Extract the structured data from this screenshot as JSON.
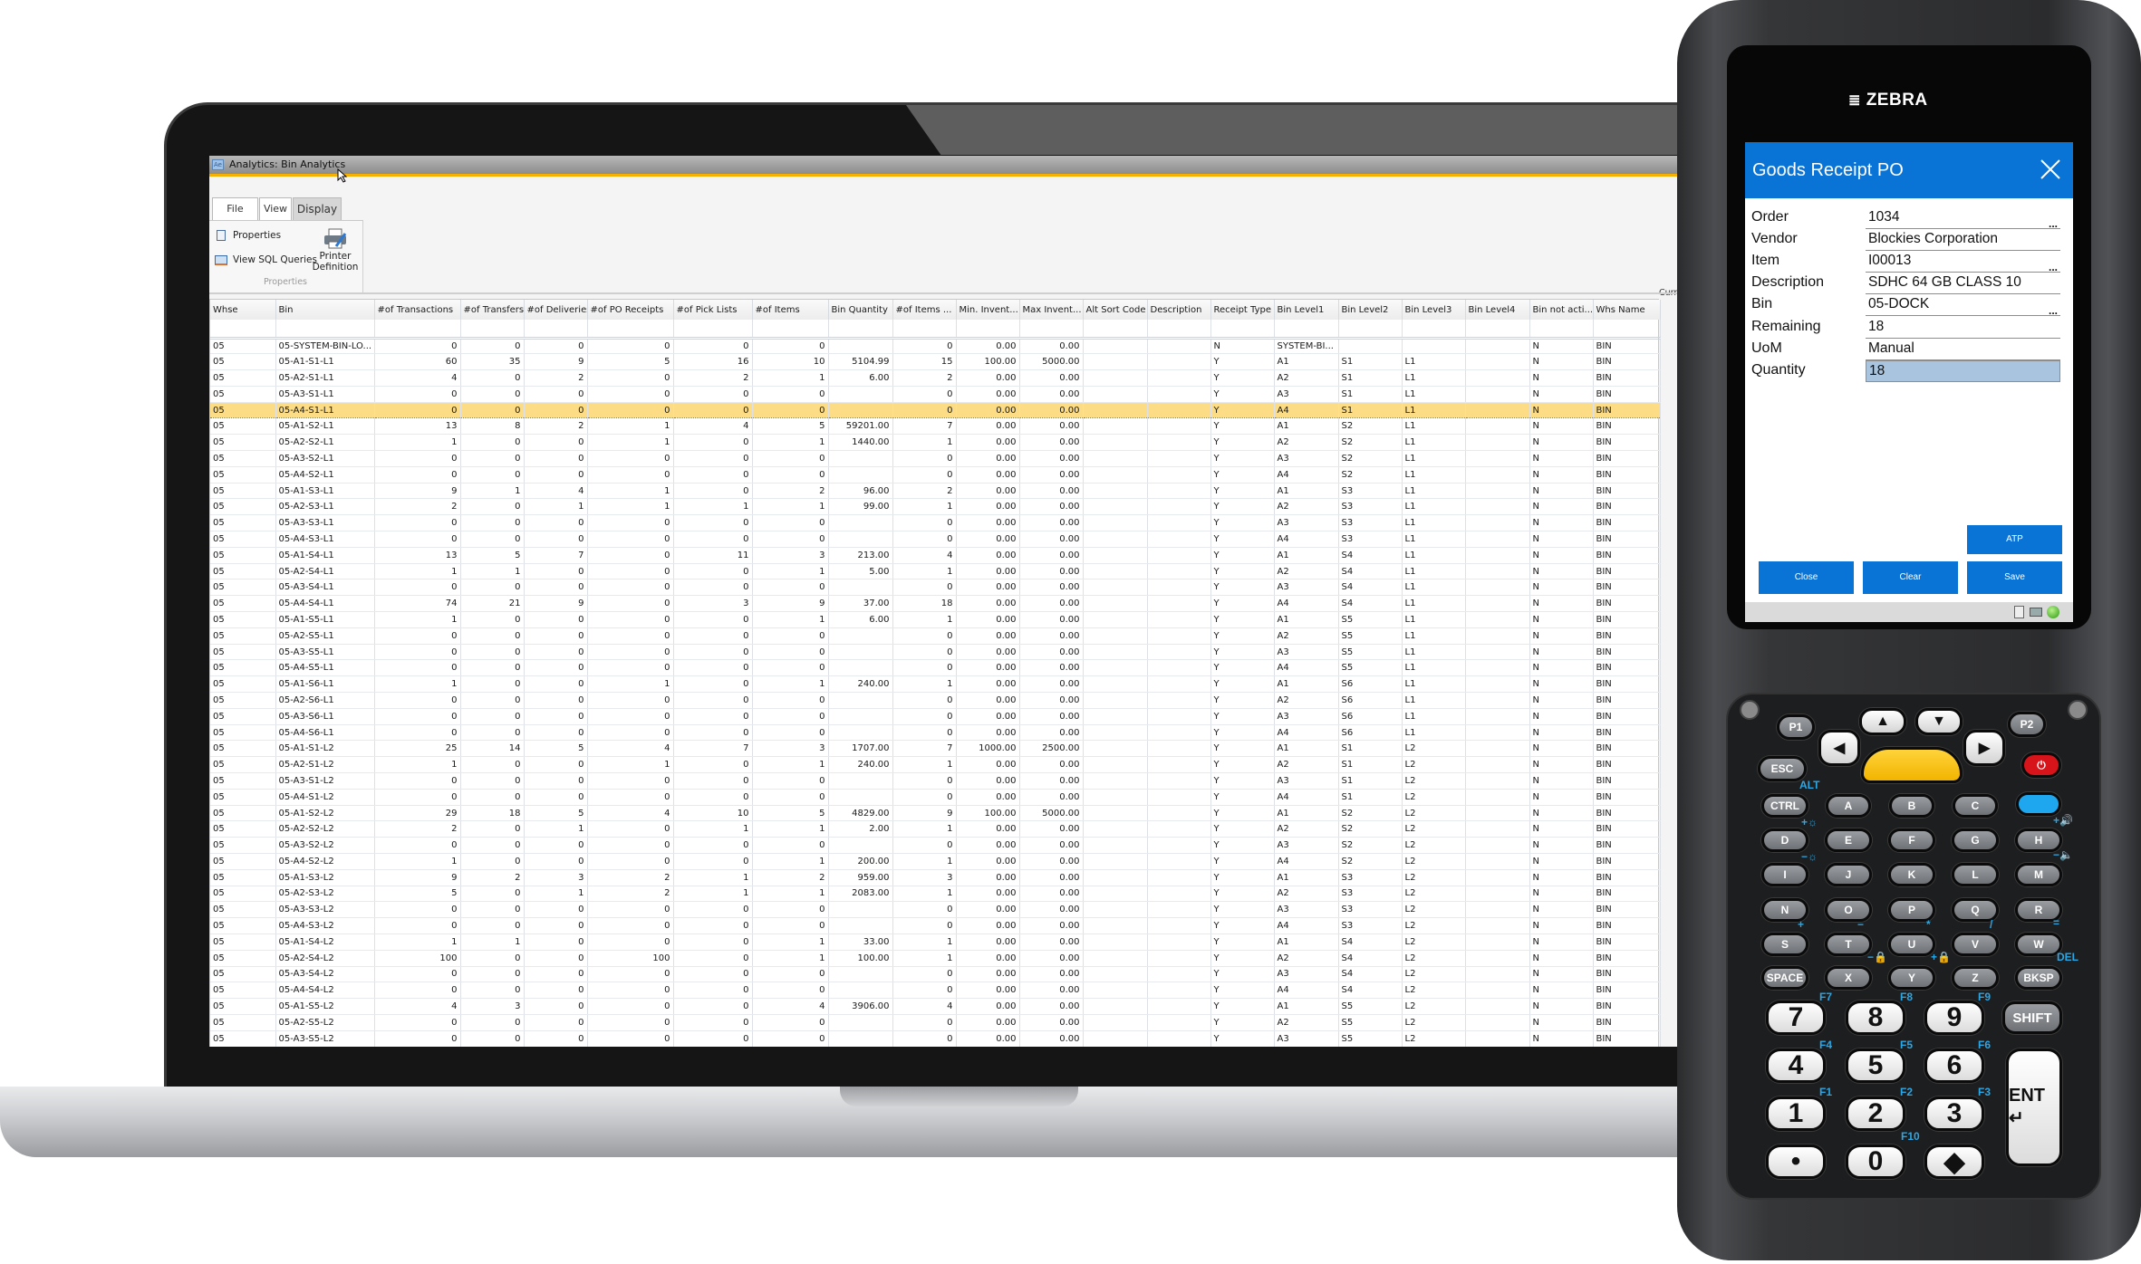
{
  "laptop": {
    "window_title": "Analytics: Bin Analytics",
    "app_icon_label": "Ae",
    "tabs": [
      "File",
      "View",
      "Display"
    ],
    "current_layout_label": "Current Layo",
    "ribbon": {
      "properties_label": "Properties",
      "view_sql_label": "View SQL Queries",
      "printer_line1": "Printer",
      "printer_line2": "Definition",
      "group_label": "Properties"
    },
    "grid": {
      "columns": [
        "Whse",
        "Bin",
        "#of Transactions",
        "#of Transfers",
        "#of Deliveries",
        "#of PO Receipts",
        "#of Pick Lists",
        "#of Items",
        "Bin Quantity",
        "#of Items ...",
        "Min. Invent...",
        "Max Invent...",
        "Alt Sort Code",
        "Description",
        "Receipt Type",
        "Bin Level1",
        "Bin Level2",
        "Bin Level3",
        "Bin Level4",
        "Bin not acti...",
        "Whs Name"
      ],
      "selected_row": 4,
      "selected_color": "#fcdc84",
      "rows": [
        [
          "05",
          "05-SYSTEM-BIN-LO...",
          "0",
          "0",
          "0",
          "0",
          "0",
          "0",
          "",
          "0",
          "0.00",
          "0.00",
          "",
          "",
          "N",
          "SYSTEM-BI...",
          "",
          "",
          "",
          "N",
          "BIN"
        ],
        [
          "05",
          "05-A1-S1-L1",
          "60",
          "35",
          "9",
          "5",
          "16",
          "10",
          "5104.99",
          "15",
          "100.00",
          "5000.00",
          "",
          "",
          "Y",
          "A1",
          "S1",
          "L1",
          "",
          "N",
          "BIN"
        ],
        [
          "05",
          "05-A2-S1-L1",
          "4",
          "0",
          "2",
          "0",
          "2",
          "1",
          "6.00",
          "2",
          "0.00",
          "0.00",
          "",
          "",
          "Y",
          "A2",
          "S1",
          "L1",
          "",
          "N",
          "BIN"
        ],
        [
          "05",
          "05-A3-S1-L1",
          "0",
          "0",
          "0",
          "0",
          "0",
          "0",
          "",
          "0",
          "0.00",
          "0.00",
          "",
          "",
          "Y",
          "A3",
          "S1",
          "L1",
          "",
          "N",
          "BIN"
        ],
        [
          "05",
          "05-A4-S1-L1",
          "0",
          "0",
          "0",
          "0",
          "0",
          "0",
          "",
          "0",
          "0.00",
          "0.00",
          "",
          "",
          "Y",
          "A4",
          "S1",
          "L1",
          "",
          "N",
          "BIN"
        ],
        [
          "05",
          "05-A1-S2-L1",
          "13",
          "8",
          "2",
          "1",
          "4",
          "5",
          "59201.00",
          "7",
          "0.00",
          "0.00",
          "",
          "",
          "Y",
          "A1",
          "S2",
          "L1",
          "",
          "N",
          "BIN"
        ],
        [
          "05",
          "05-A2-S2-L1",
          "1",
          "0",
          "0",
          "1",
          "0",
          "1",
          "1440.00",
          "1",
          "0.00",
          "0.00",
          "",
          "",
          "Y",
          "A2",
          "S2",
          "L1",
          "",
          "N",
          "BIN"
        ],
        [
          "05",
          "05-A3-S2-L1",
          "0",
          "0",
          "0",
          "0",
          "0",
          "0",
          "",
          "0",
          "0.00",
          "0.00",
          "",
          "",
          "Y",
          "A3",
          "S2",
          "L1",
          "",
          "N",
          "BIN"
        ],
        [
          "05",
          "05-A4-S2-L1",
          "0",
          "0",
          "0",
          "0",
          "0",
          "0",
          "",
          "0",
          "0.00",
          "0.00",
          "",
          "",
          "Y",
          "A4",
          "S2",
          "L1",
          "",
          "N",
          "BIN"
        ],
        [
          "05",
          "05-A1-S3-L1",
          "9",
          "1",
          "4",
          "1",
          "0",
          "2",
          "96.00",
          "2",
          "0.00",
          "0.00",
          "",
          "",
          "Y",
          "A1",
          "S3",
          "L1",
          "",
          "N",
          "BIN"
        ],
        [
          "05",
          "05-A2-S3-L1",
          "2",
          "0",
          "1",
          "1",
          "1",
          "1",
          "99.00",
          "1",
          "0.00",
          "0.00",
          "",
          "",
          "Y",
          "A2",
          "S3",
          "L1",
          "",
          "N",
          "BIN"
        ],
        [
          "05",
          "05-A3-S3-L1",
          "0",
          "0",
          "0",
          "0",
          "0",
          "0",
          "",
          "0",
          "0.00",
          "0.00",
          "",
          "",
          "Y",
          "A3",
          "S3",
          "L1",
          "",
          "N",
          "BIN"
        ],
        [
          "05",
          "05-A4-S3-L1",
          "0",
          "0",
          "0",
          "0",
          "0",
          "0",
          "",
          "0",
          "0.00",
          "0.00",
          "",
          "",
          "Y",
          "A4",
          "S3",
          "L1",
          "",
          "N",
          "BIN"
        ],
        [
          "05",
          "05-A1-S4-L1",
          "13",
          "5",
          "7",
          "0",
          "11",
          "3",
          "213.00",
          "4",
          "0.00",
          "0.00",
          "",
          "",
          "Y",
          "A1",
          "S4",
          "L1",
          "",
          "N",
          "BIN"
        ],
        [
          "05",
          "05-A2-S4-L1",
          "1",
          "1",
          "0",
          "0",
          "0",
          "1",
          "5.00",
          "1",
          "0.00",
          "0.00",
          "",
          "",
          "Y",
          "A2",
          "S4",
          "L1",
          "",
          "N",
          "BIN"
        ],
        [
          "05",
          "05-A3-S4-L1",
          "0",
          "0",
          "0",
          "0",
          "0",
          "0",
          "",
          "0",
          "0.00",
          "0.00",
          "",
          "",
          "Y",
          "A3",
          "S4",
          "L1",
          "",
          "N",
          "BIN"
        ],
        [
          "05",
          "05-A4-S4-L1",
          "74",
          "21",
          "9",
          "0",
          "3",
          "9",
          "37.00",
          "18",
          "0.00",
          "0.00",
          "",
          "",
          "Y",
          "A4",
          "S4",
          "L1",
          "",
          "N",
          "BIN"
        ],
        [
          "05",
          "05-A1-S5-L1",
          "1",
          "0",
          "0",
          "0",
          "0",
          "1",
          "6.00",
          "1",
          "0.00",
          "0.00",
          "",
          "",
          "Y",
          "A1",
          "S5",
          "L1",
          "",
          "N",
          "BIN"
        ],
        [
          "05",
          "05-A2-S5-L1",
          "0",
          "0",
          "0",
          "0",
          "0",
          "0",
          "",
          "0",
          "0.00",
          "0.00",
          "",
          "",
          "Y",
          "A2",
          "S5",
          "L1",
          "",
          "N",
          "BIN"
        ],
        [
          "05",
          "05-A3-S5-L1",
          "0",
          "0",
          "0",
          "0",
          "0",
          "0",
          "",
          "0",
          "0.00",
          "0.00",
          "",
          "",
          "Y",
          "A3",
          "S5",
          "L1",
          "",
          "N",
          "BIN"
        ],
        [
          "05",
          "05-A4-S5-L1",
          "0",
          "0",
          "0",
          "0",
          "0",
          "0",
          "",
          "0",
          "0.00",
          "0.00",
          "",
          "",
          "Y",
          "A4",
          "S5",
          "L1",
          "",
          "N",
          "BIN"
        ],
        [
          "05",
          "05-A1-S6-L1",
          "1",
          "0",
          "0",
          "1",
          "0",
          "1",
          "240.00",
          "1",
          "0.00",
          "0.00",
          "",
          "",
          "Y",
          "A1",
          "S6",
          "L1",
          "",
          "N",
          "BIN"
        ],
        [
          "05",
          "05-A2-S6-L1",
          "0",
          "0",
          "0",
          "0",
          "0",
          "0",
          "",
          "0",
          "0.00",
          "0.00",
          "",
          "",
          "Y",
          "A2",
          "S6",
          "L1",
          "",
          "N",
          "BIN"
        ],
        [
          "05",
          "05-A3-S6-L1",
          "0",
          "0",
          "0",
          "0",
          "0",
          "0",
          "",
          "0",
          "0.00",
          "0.00",
          "",
          "",
          "Y",
          "A3",
          "S6",
          "L1",
          "",
          "N",
          "BIN"
        ],
        [
          "05",
          "05-A4-S6-L1",
          "0",
          "0",
          "0",
          "0",
          "0",
          "0",
          "",
          "0",
          "0.00",
          "0.00",
          "",
          "",
          "Y",
          "A4",
          "S6",
          "L1",
          "",
          "N",
          "BIN"
        ],
        [
          "05",
          "05-A1-S1-L2",
          "25",
          "14",
          "5",
          "4",
          "7",
          "3",
          "1707.00",
          "7",
          "1000.00",
          "2500.00",
          "",
          "",
          "Y",
          "A1",
          "S1",
          "L2",
          "",
          "N",
          "BIN"
        ],
        [
          "05",
          "05-A2-S1-L2",
          "1",
          "0",
          "0",
          "1",
          "0",
          "1",
          "240.00",
          "1",
          "0.00",
          "0.00",
          "",
          "",
          "Y",
          "A2",
          "S1",
          "L2",
          "",
          "N",
          "BIN"
        ],
        [
          "05",
          "05-A3-S1-L2",
          "0",
          "0",
          "0",
          "0",
          "0",
          "0",
          "",
          "0",
          "0.00",
          "0.00",
          "",
          "",
          "Y",
          "A3",
          "S1",
          "L2",
          "",
          "N",
          "BIN"
        ],
        [
          "05",
          "05-A4-S1-L2",
          "0",
          "0",
          "0",
          "0",
          "0",
          "0",
          "",
          "0",
          "0.00",
          "0.00",
          "",
          "",
          "Y",
          "A4",
          "S1",
          "L2",
          "",
          "N",
          "BIN"
        ],
        [
          "05",
          "05-A1-S2-L2",
          "29",
          "18",
          "5",
          "4",
          "10",
          "5",
          "4829.00",
          "9",
          "100.00",
          "5000.00",
          "",
          "",
          "Y",
          "A1",
          "S2",
          "L2",
          "",
          "N",
          "BIN"
        ],
        [
          "05",
          "05-A2-S2-L2",
          "2",
          "0",
          "1",
          "0",
          "1",
          "1",
          "2.00",
          "1",
          "0.00",
          "0.00",
          "",
          "",
          "Y",
          "A2",
          "S2",
          "L2",
          "",
          "N",
          "BIN"
        ],
        [
          "05",
          "05-A3-S2-L2",
          "0",
          "0",
          "0",
          "0",
          "0",
          "0",
          "",
          "0",
          "0.00",
          "0.00",
          "",
          "",
          "Y",
          "A3",
          "S2",
          "L2",
          "",
          "N",
          "BIN"
        ],
        [
          "05",
          "05-A4-S2-L2",
          "1",
          "0",
          "0",
          "0",
          "0",
          "1",
          "200.00",
          "1",
          "0.00",
          "0.00",
          "",
          "",
          "Y",
          "A4",
          "S2",
          "L2",
          "",
          "N",
          "BIN"
        ],
        [
          "05",
          "05-A1-S3-L2",
          "9",
          "2",
          "3",
          "2",
          "1",
          "2",
          "959.00",
          "3",
          "0.00",
          "0.00",
          "",
          "",
          "Y",
          "A1",
          "S3",
          "L2",
          "",
          "N",
          "BIN"
        ],
        [
          "05",
          "05-A2-S3-L2",
          "5",
          "0",
          "1",
          "2",
          "1",
          "1",
          "2083.00",
          "1",
          "0.00",
          "0.00",
          "",
          "",
          "Y",
          "A2",
          "S3",
          "L2",
          "",
          "N",
          "BIN"
        ],
        [
          "05",
          "05-A3-S3-L2",
          "0",
          "0",
          "0",
          "0",
          "0",
          "0",
          "",
          "0",
          "0.00",
          "0.00",
          "",
          "",
          "Y",
          "A3",
          "S3",
          "L2",
          "",
          "N",
          "BIN"
        ],
        [
          "05",
          "05-A4-S3-L2",
          "0",
          "0",
          "0",
          "0",
          "0",
          "0",
          "",
          "0",
          "0.00",
          "0.00",
          "",
          "",
          "Y",
          "A4",
          "S3",
          "L2",
          "",
          "N",
          "BIN"
        ],
        [
          "05",
          "05-A1-S4-L2",
          "1",
          "1",
          "0",
          "0",
          "0",
          "1",
          "33.00",
          "1",
          "0.00",
          "0.00",
          "",
          "",
          "Y",
          "A1",
          "S4",
          "L2",
          "",
          "N",
          "BIN"
        ],
        [
          "05",
          "05-A2-S4-L2",
          "100",
          "0",
          "0",
          "100",
          "0",
          "1",
          "100.00",
          "1",
          "0.00",
          "0.00",
          "",
          "",
          "Y",
          "A2",
          "S4",
          "L2",
          "",
          "N",
          "BIN"
        ],
        [
          "05",
          "05-A3-S4-L2",
          "0",
          "0",
          "0",
          "0",
          "0",
          "0",
          "",
          "0",
          "0.00",
          "0.00",
          "",
          "",
          "Y",
          "A3",
          "S4",
          "L2",
          "",
          "N",
          "BIN"
        ],
        [
          "05",
          "05-A4-S4-L2",
          "0",
          "0",
          "0",
          "0",
          "0",
          "0",
          "",
          "0",
          "0.00",
          "0.00",
          "",
          "",
          "Y",
          "A4",
          "S4",
          "L2",
          "",
          "N",
          "BIN"
        ],
        [
          "05",
          "05-A1-S5-L2",
          "4",
          "3",
          "0",
          "0",
          "0",
          "4",
          "3906.00",
          "4",
          "0.00",
          "0.00",
          "",
          "",
          "Y",
          "A1",
          "S5",
          "L2",
          "",
          "N",
          "BIN"
        ],
        [
          "05",
          "05-A2-S5-L2",
          "0",
          "0",
          "0",
          "0",
          "0",
          "0",
          "",
          "0",
          "0.00",
          "0.00",
          "",
          "",
          "Y",
          "A2",
          "S5",
          "L2",
          "",
          "N",
          "BIN"
        ],
        [
          "05",
          "05-A3-S5-L2",
          "0",
          "0",
          "0",
          "0",
          "0",
          "0",
          "",
          "0",
          "0.00",
          "0.00",
          "",
          "",
          "Y",
          "A3",
          "S5",
          "L2",
          "",
          "N",
          "BIN"
        ]
      ]
    }
  },
  "device": {
    "brand": "ZEBRA",
    "app": {
      "title": "Goods Receipt PO",
      "accent": "#0a74d6",
      "fields": [
        {
          "label": "Order",
          "value": "1034",
          "lookup": "..."
        },
        {
          "label": "Vendor",
          "value": "Blockies Corporation"
        },
        {
          "label": "Item",
          "value": "I00013",
          "lookup": "..."
        },
        {
          "label": "Description",
          "value": "SDHC 64 GB CLASS 10"
        },
        {
          "label": "Bin",
          "value": "05-DOCK",
          "lookup": "..."
        },
        {
          "label": "Remaining",
          "value": "18"
        },
        {
          "label": "UoM",
          "value": "Manual"
        },
        {
          "label": "Quantity",
          "value": "18"
        }
      ],
      "buttons": {
        "atp": "ATP",
        "close": "Close",
        "clear": "Clear",
        "save": "Save"
      },
      "status_icons": [
        "calculator-icon",
        "printer-icon",
        "connection-status-icon"
      ]
    },
    "keypad": {
      "keys": [
        "P1",
        "P2",
        "ESC",
        "⏻",
        "▲",
        "▼",
        "◀",
        "▶",
        "",
        "CTRL",
        "A",
        "B",
        "C",
        "",
        "D",
        "E",
        "F",
        "G",
        "H",
        "I",
        "J",
        "K",
        "L",
        "M",
        "N",
        "O",
        "P",
        "Q",
        "R",
        "S",
        "T",
        "U",
        "V",
        "W",
        "SPACE",
        "X",
        "Y",
        "Z",
        "BKSP",
        "7",
        "8",
        "9",
        "SHIFT",
        "4",
        "5",
        "6",
        "1",
        "2",
        "3",
        "ENT ↵",
        "•",
        "0",
        "◆"
      ],
      "secondary": [
        "ALT",
        "+☼",
        "−☼",
        "+🔊",
        "−🔈",
        "+",
        "−",
        "*",
        "/",
        "=",
        "−🔒",
        "+🔒",
        "DEL",
        "F7",
        "F8",
        "F9",
        "F4",
        "F5",
        "F6",
        "F1",
        "F2",
        "F3",
        "F10"
      ]
    }
  }
}
